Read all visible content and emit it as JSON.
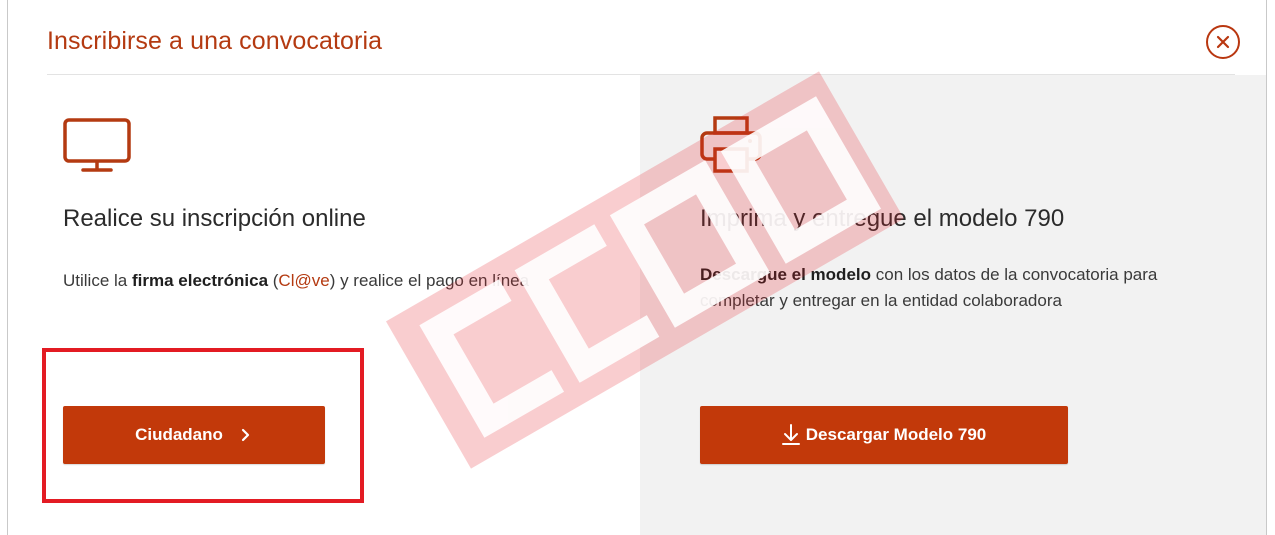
{
  "modal": {
    "title": "Inscribirse a una convocatoria",
    "close_icon": "circle-x-icon"
  },
  "online_option": {
    "icon": "monitor-icon",
    "title": "Realice su inscripción online",
    "desc_prefix": "Utilice la ",
    "desc_bold": "firma electrónica",
    "desc_open_paren": " (",
    "desc_link": "Cl@ve",
    "desc_suffix": ") y realice el pago en línea",
    "button_label": "Ciudadano",
    "button_icon": "chevron-right-icon"
  },
  "print_option": {
    "icon": "printer-icon",
    "title": "Imprima y entregue el modelo 790",
    "desc_bold": "Descargue el modelo",
    "desc_suffix": " con los datos de la convocatoria para completar y entregar en la entidad colaboradora",
    "button_label": "Descargar Modelo 790",
    "button_icon": "download-icon"
  },
  "overlay": {
    "watermark": "CCOO watermark logo",
    "highlight_color": "#e31b23"
  },
  "colors": {
    "accent": "#b43a11",
    "button": "#c2390a",
    "panel_bg": "#f2f2f2"
  }
}
